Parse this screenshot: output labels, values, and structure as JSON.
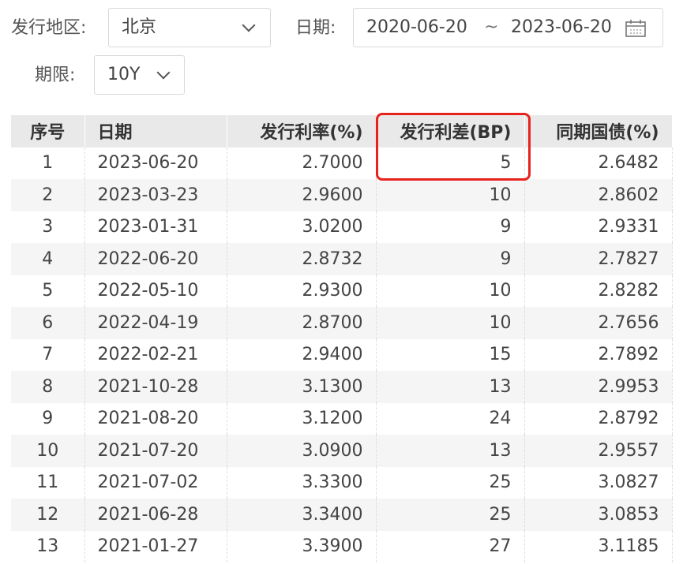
{
  "filters": {
    "region_label": "发行地区:",
    "region_value": "北京",
    "date_label": "日期:",
    "date_start": "2020-06-20",
    "date_sep": "~",
    "date_end": "2023-06-20",
    "term_label": "期限:",
    "term_value": "10Y"
  },
  "table": {
    "headers": [
      "序号",
      "日期",
      "发行利率(%)",
      "发行利差(BP)",
      "同期国债(%)"
    ],
    "rows": [
      [
        "1",
        "2023-06-20",
        "2.7000",
        "5",
        "2.6482"
      ],
      [
        "2",
        "2023-03-23",
        "2.9600",
        "10",
        "2.8602"
      ],
      [
        "3",
        "2023-01-31",
        "3.0200",
        "9",
        "2.9331"
      ],
      [
        "4",
        "2022-06-20",
        "2.8732",
        "9",
        "2.7827"
      ],
      [
        "5",
        "2022-05-10",
        "2.9300",
        "10",
        "2.8282"
      ],
      [
        "6",
        "2022-04-19",
        "2.8700",
        "10",
        "2.7656"
      ],
      [
        "7",
        "2022-02-21",
        "2.9400",
        "15",
        "2.7892"
      ],
      [
        "8",
        "2021-10-28",
        "3.1300",
        "13",
        "2.9953"
      ],
      [
        "9",
        "2021-08-20",
        "3.1200",
        "24",
        "2.8792"
      ],
      [
        "10",
        "2021-07-20",
        "3.0900",
        "13",
        "2.9557"
      ],
      [
        "11",
        "2021-07-02",
        "3.3300",
        "25",
        "3.0827"
      ],
      [
        "12",
        "2021-06-28",
        "3.3400",
        "25",
        "3.0853"
      ],
      [
        "13",
        "2021-01-27",
        "3.3900",
        "27",
        "3.1185"
      ]
    ]
  },
  "colors": {
    "highlight": "#e8231d",
    "header_bg": "#e9e9e9",
    "stripe_bg": "#f5f5f5"
  }
}
